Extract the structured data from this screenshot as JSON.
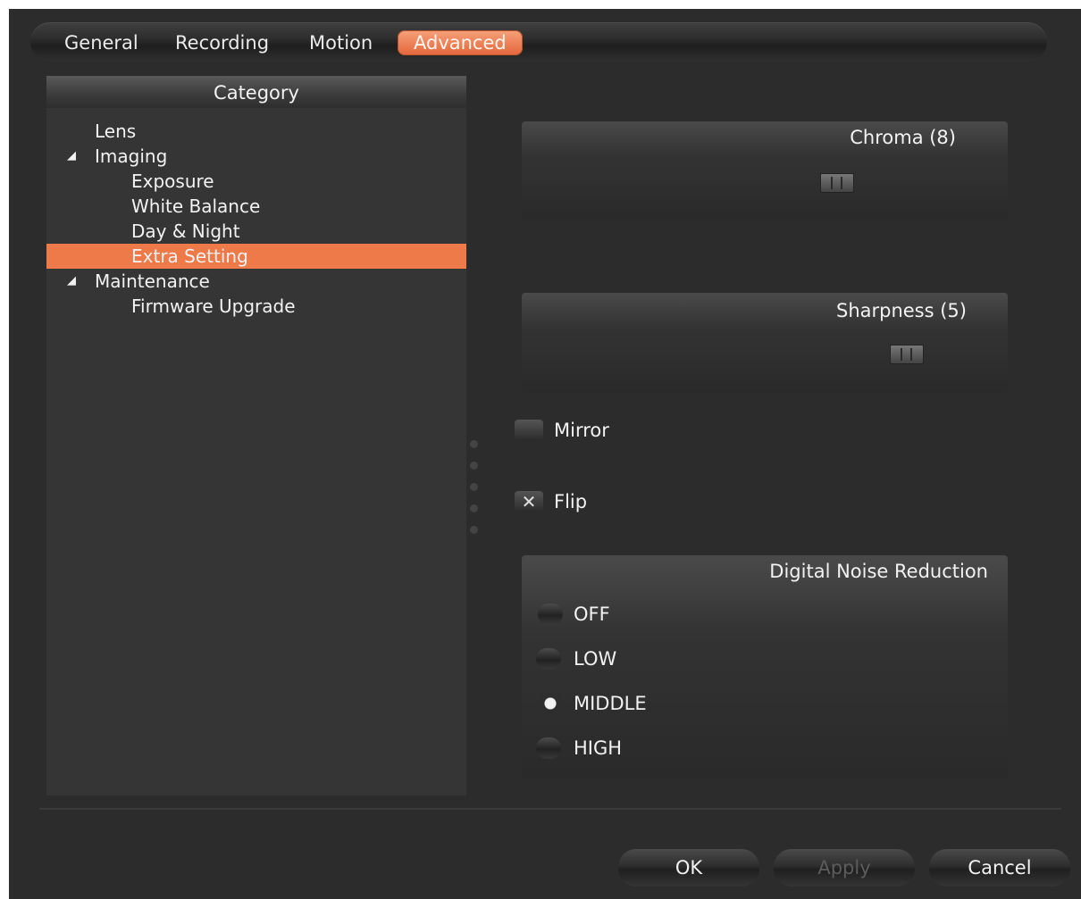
{
  "tabs": [
    {
      "label": "General"
    },
    {
      "label": "Recording"
    },
    {
      "label": "Motion"
    },
    {
      "label": "Advanced",
      "active": true
    }
  ],
  "category": {
    "header": "Category",
    "items": [
      {
        "label": "Lens",
        "level": 1
      },
      {
        "label": "Imaging",
        "level": 1,
        "expanded": true
      },
      {
        "label": "Exposure",
        "level": 2
      },
      {
        "label": "White Balance",
        "level": 2
      },
      {
        "label": "Day & Night",
        "level": 2
      },
      {
        "label": "Extra Setting",
        "level": 2,
        "selected": true
      },
      {
        "label": "Maintenance",
        "level": 1,
        "expanded": true
      },
      {
        "label": "Firmware Upgrade",
        "level": 2
      }
    ]
  },
  "settings": {
    "chroma": {
      "title": "Chroma (8)",
      "value": 8
    },
    "sharpness": {
      "title": "Sharpness (5)",
      "value": 5
    },
    "mirror": {
      "label": "Mirror",
      "checked": false
    },
    "flip": {
      "label": "Flip",
      "checked": true,
      "mark": "✕"
    },
    "dnr": {
      "title": "Digital Noise Reduction",
      "options": [
        {
          "label": "OFF",
          "selected": false
        },
        {
          "label": "LOW",
          "selected": false
        },
        {
          "label": "MIDDLE",
          "selected": true
        },
        {
          "label": "HIGH",
          "selected": false
        }
      ]
    }
  },
  "buttons": {
    "ok": "OK",
    "apply": "Apply",
    "cancel": "Cancel"
  },
  "colors": {
    "accent": "#ee7a4a",
    "background": "#2c2c2c",
    "panel": "#353535"
  }
}
